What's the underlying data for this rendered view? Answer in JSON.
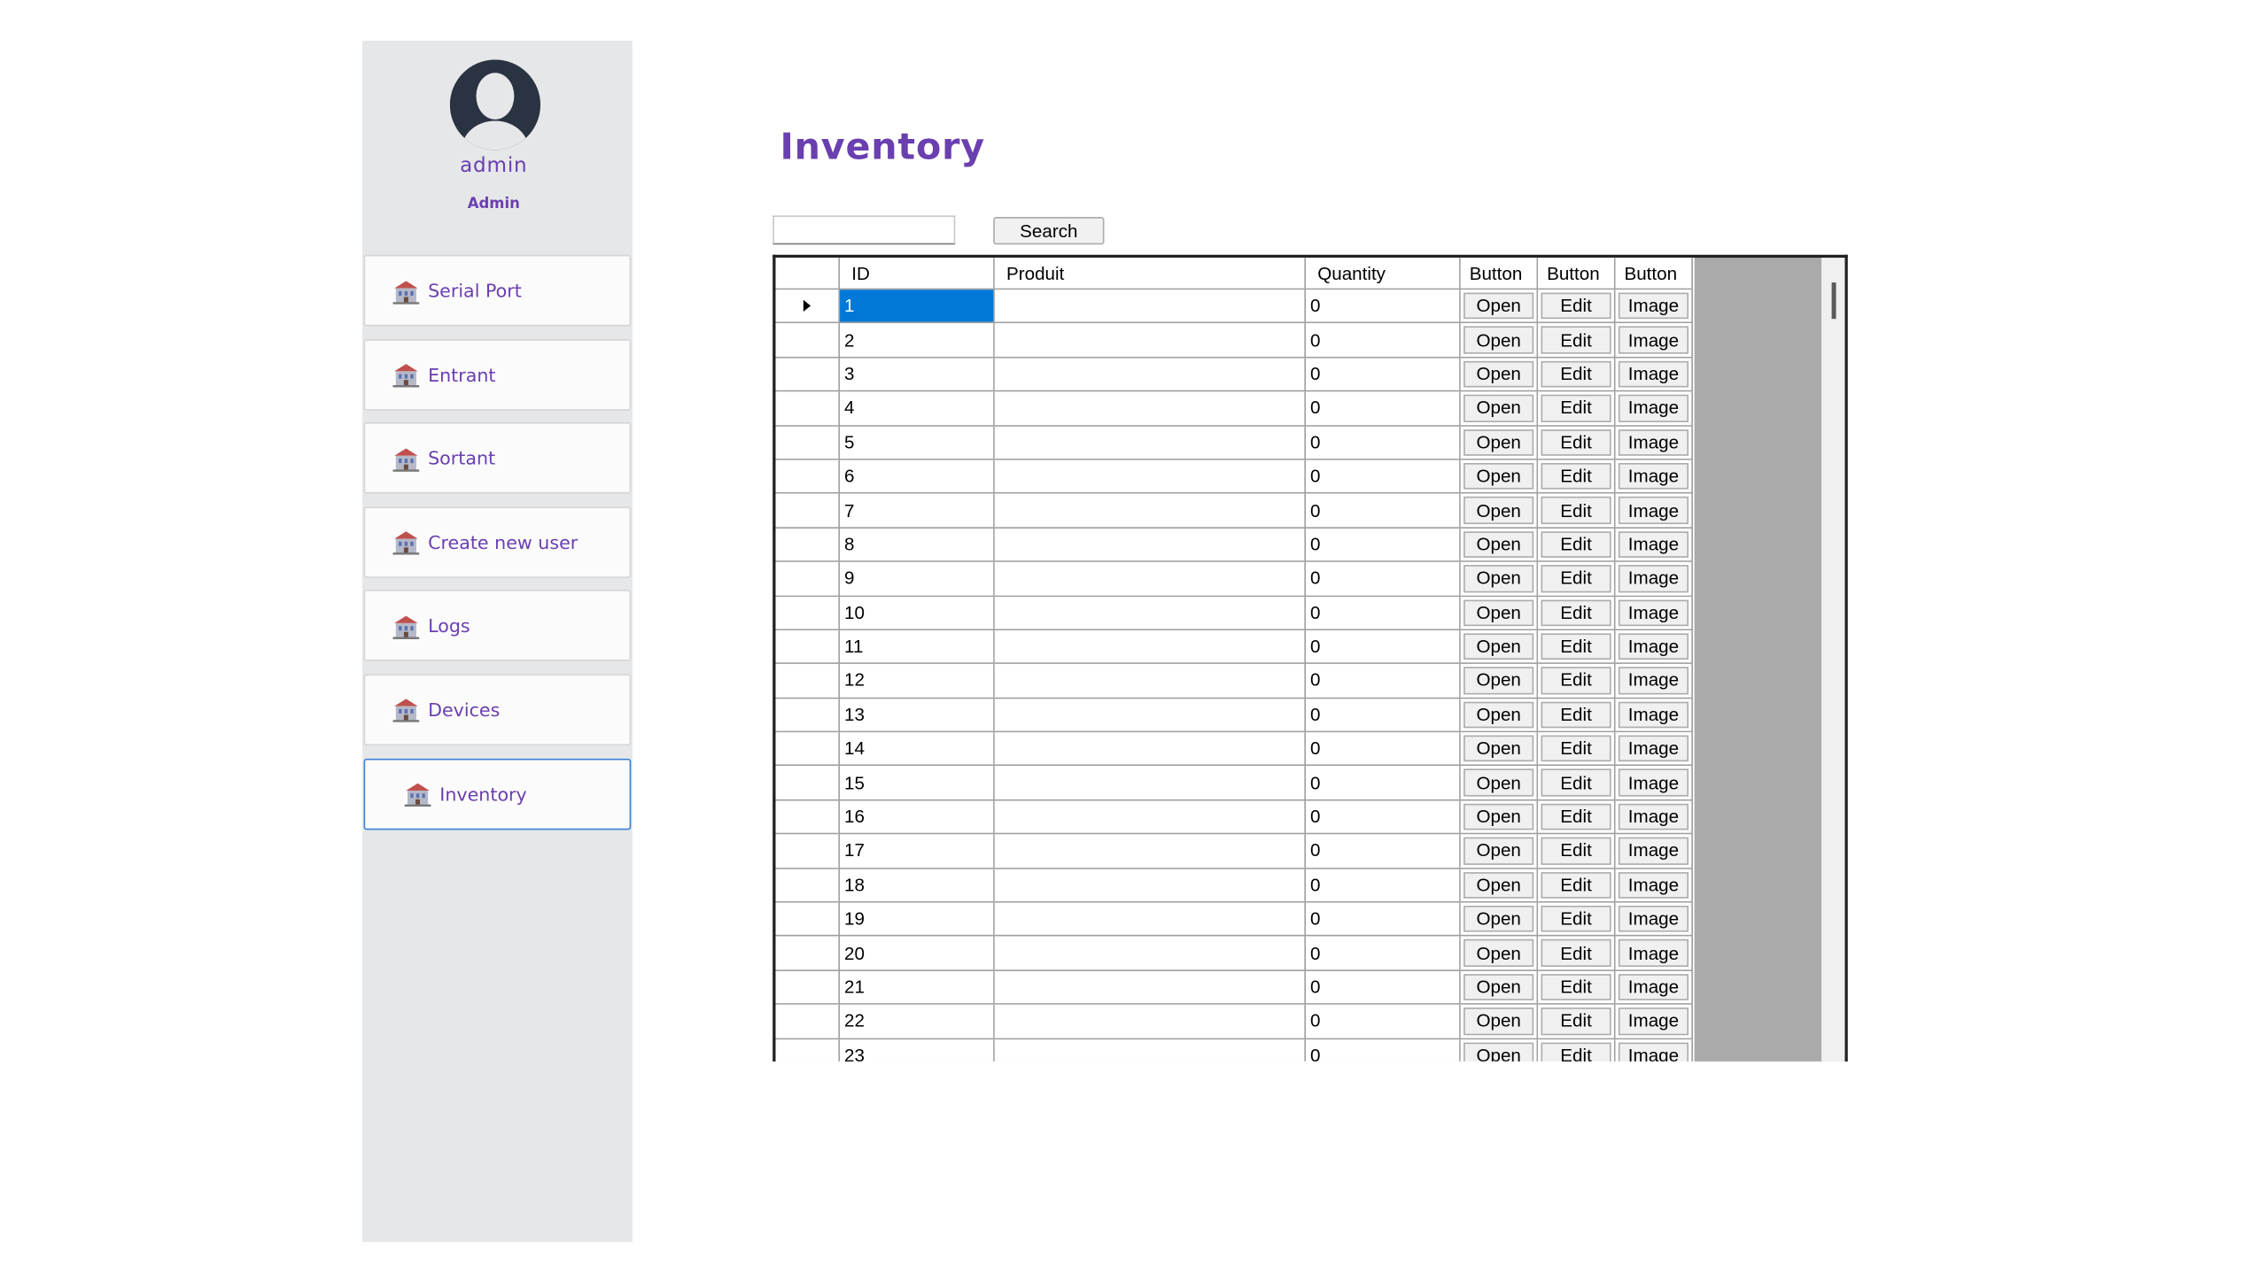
{
  "sidebar": {
    "user": {
      "name": "admin",
      "role": "Admin"
    },
    "items": [
      {
        "label": "Serial Port",
        "icon": "building-icon",
        "active": false
      },
      {
        "label": "Entrant",
        "icon": "building-icon",
        "active": false
      },
      {
        "label": "Sortant",
        "icon": "building-icon",
        "active": false
      },
      {
        "label": "Create new user",
        "icon": "building-icon",
        "active": false
      },
      {
        "label": "Logs",
        "icon": "building-icon",
        "active": false
      },
      {
        "label": "Devices",
        "icon": "building-icon",
        "active": false
      },
      {
        "label": "Inventory",
        "icon": "building-icon",
        "active": true
      }
    ]
  },
  "main": {
    "title": "Inventory",
    "search": {
      "value": "",
      "placeholder": "",
      "button_label": "Search"
    },
    "table": {
      "columns": [
        "ID",
        "Produit",
        "Quantity",
        "Button",
        "Button",
        "Button"
      ],
      "rows": [
        {
          "id": "1",
          "produit": "",
          "quantity": "0",
          "open": "Open",
          "edit": "Edit",
          "image": "Image",
          "selected": true
        },
        {
          "id": "2",
          "produit": "",
          "quantity": "0",
          "open": "Open",
          "edit": "Edit",
          "image": "Image"
        },
        {
          "id": "3",
          "produit": "",
          "quantity": "0",
          "open": "Open",
          "edit": "Edit",
          "image": "Image"
        },
        {
          "id": "4",
          "produit": "",
          "quantity": "0",
          "open": "Open",
          "edit": "Edit",
          "image": "Image"
        },
        {
          "id": "5",
          "produit": "",
          "quantity": "0",
          "open": "Open",
          "edit": "Edit",
          "image": "Image"
        },
        {
          "id": "6",
          "produit": "",
          "quantity": "0",
          "open": "Open",
          "edit": "Edit",
          "image": "Image"
        },
        {
          "id": "7",
          "produit": "",
          "quantity": "0",
          "open": "Open",
          "edit": "Edit",
          "image": "Image"
        },
        {
          "id": "8",
          "produit": "",
          "quantity": "0",
          "open": "Open",
          "edit": "Edit",
          "image": "Image"
        },
        {
          "id": "9",
          "produit": "",
          "quantity": "0",
          "open": "Open",
          "edit": "Edit",
          "image": "Image"
        },
        {
          "id": "10",
          "produit": "",
          "quantity": "0",
          "open": "Open",
          "edit": "Edit",
          "image": "Image"
        },
        {
          "id": "11",
          "produit": "",
          "quantity": "0",
          "open": "Open",
          "edit": "Edit",
          "image": "Image"
        },
        {
          "id": "12",
          "produit": "",
          "quantity": "0",
          "open": "Open",
          "edit": "Edit",
          "image": "Image"
        },
        {
          "id": "13",
          "produit": "",
          "quantity": "0",
          "open": "Open",
          "edit": "Edit",
          "image": "Image"
        },
        {
          "id": "14",
          "produit": "",
          "quantity": "0",
          "open": "Open",
          "edit": "Edit",
          "image": "Image"
        },
        {
          "id": "15",
          "produit": "",
          "quantity": "0",
          "open": "Open",
          "edit": "Edit",
          "image": "Image"
        },
        {
          "id": "16",
          "produit": "",
          "quantity": "0",
          "open": "Open",
          "edit": "Edit",
          "image": "Image"
        },
        {
          "id": "17",
          "produit": "",
          "quantity": "0",
          "open": "Open",
          "edit": "Edit",
          "image": "Image"
        },
        {
          "id": "18",
          "produit": "",
          "quantity": "0",
          "open": "Open",
          "edit": "Edit",
          "image": "Image"
        },
        {
          "id": "19",
          "produit": "",
          "quantity": "0",
          "open": "Open",
          "edit": "Edit",
          "image": "Image"
        },
        {
          "id": "20",
          "produit": "",
          "quantity": "0",
          "open": "Open",
          "edit": "Edit",
          "image": "Image"
        },
        {
          "id": "21",
          "produit": "",
          "quantity": "0",
          "open": "Open",
          "edit": "Edit",
          "image": "Image"
        },
        {
          "id": "22",
          "produit": "",
          "quantity": "0",
          "open": "Open",
          "edit": "Edit",
          "image": "Image"
        },
        {
          "id": "23",
          "produit": "",
          "quantity": "0",
          "open": "Open",
          "edit": "Edit",
          "image": "Image"
        }
      ]
    }
  },
  "colors": {
    "accent": "#6a3fb0",
    "sidebar_bg": "#e6e7e9",
    "selection": "#0078d7",
    "active_border": "#3b82d6",
    "grid_empty": "#aaaaaa"
  }
}
